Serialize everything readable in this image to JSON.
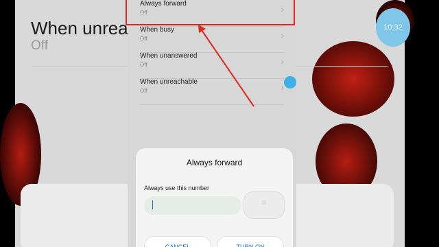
{
  "background": {
    "title": "When unreachable",
    "subtitle": "Off",
    "bubble_text": "10:32"
  },
  "list": {
    "items": [
      {
        "label": "Always forward",
        "state": "Off"
      },
      {
        "label": "When busy",
        "state": "Off"
      },
      {
        "label": "When unanswered",
        "state": "Off"
      },
      {
        "label": "When unreachable",
        "state": "Off"
      }
    ]
  },
  "dialog": {
    "title": "Always forward",
    "field_label": "Always use this number",
    "number_value": "",
    "cancel_label": "CANCEL",
    "turn_on_label": "TURN ON"
  },
  "annotation": {
    "color": "#e0271b"
  }
}
